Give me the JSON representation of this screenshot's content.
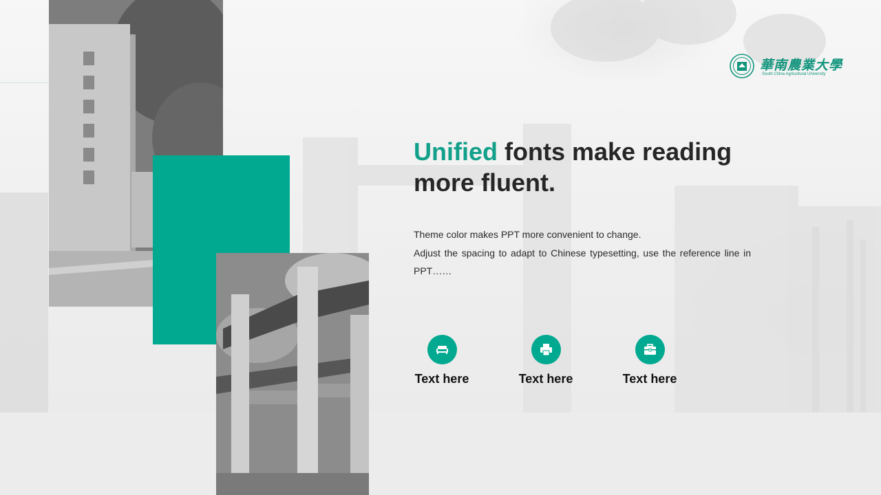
{
  "logo": {
    "name": "華南農業大學",
    "subtitle": "South China Agricultural University",
    "color": "#12957d"
  },
  "headline": {
    "highlight": "Unified",
    "rest": " fonts make reading more fluent."
  },
  "body": {
    "line1": "Theme color makes PPT more convenient to change.",
    "line2": "Adjust the spacing to adapt to Chinese typesetting, use the reference line in PPT……"
  },
  "features": [
    {
      "icon": "sofa-icon",
      "label": "Text here"
    },
    {
      "icon": "printer-icon",
      "label": "Text here"
    },
    {
      "icon": "briefcase-icon",
      "label": "Text here"
    }
  ],
  "colors": {
    "accent": "#00a98f",
    "text": "#262626"
  }
}
